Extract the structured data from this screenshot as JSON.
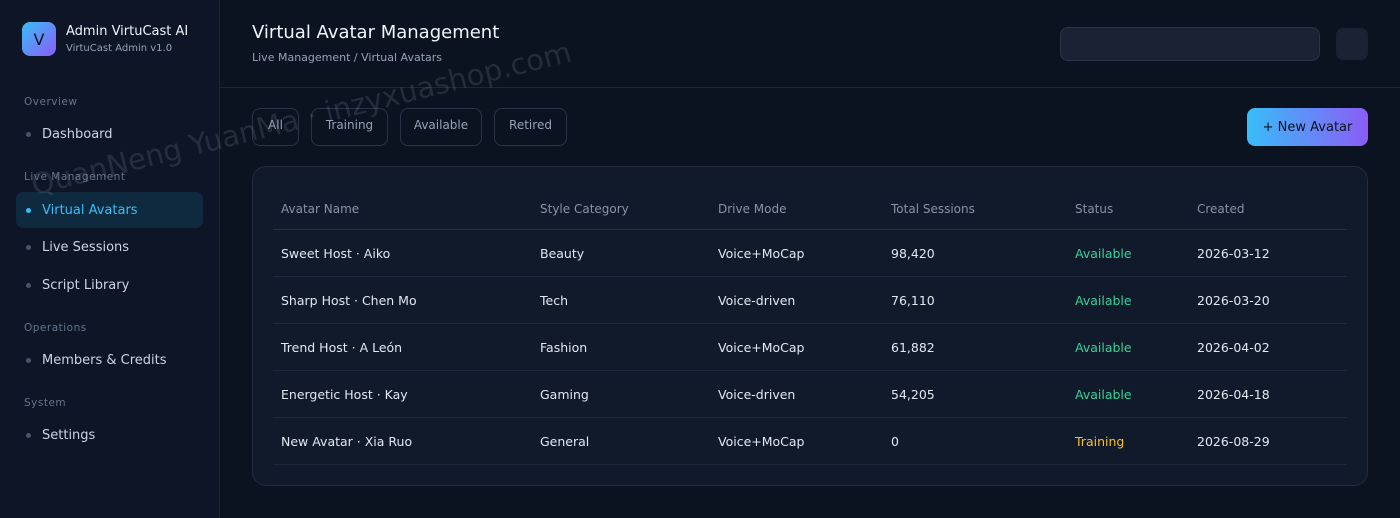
{
  "brand": {
    "logo_letter": "V",
    "name": "Admin VirtuCast AI",
    "subtitle": "VirtuCast Admin v1.0"
  },
  "sidebar": {
    "sections": [
      {
        "title": "Overview",
        "items": [
          {
            "label": "Dashboard",
            "active": false
          }
        ]
      },
      {
        "title": "Live Management",
        "items": [
          {
            "label": "Virtual Avatars",
            "active": true
          },
          {
            "label": "Live Sessions",
            "active": false
          },
          {
            "label": "Script Library",
            "active": false
          }
        ]
      },
      {
        "title": "Operations",
        "items": [
          {
            "label": "Members & Credits",
            "active": false
          }
        ]
      },
      {
        "title": "System",
        "items": [
          {
            "label": "Settings",
            "active": false
          }
        ]
      }
    ]
  },
  "header": {
    "title": "Virtual Avatar Management",
    "breadcrumb": "Live Management / Virtual Avatars",
    "search": {
      "value": "",
      "placeholder": ""
    }
  },
  "filters": [
    "All",
    "Training",
    "Available",
    "Retired"
  ],
  "new_button_label": "+ New Avatar",
  "table": {
    "columns": [
      "Avatar Name",
      "Style Category",
      "Drive Mode",
      "Total Sessions",
      "Status",
      "Created"
    ],
    "rows": [
      [
        "Sweet Host · Aiko",
        "Beauty",
        "Voice+MoCap",
        "98,420",
        "Available",
        "2026-03-12"
      ],
      [
        "Sharp Host · Chen Mo",
        "Tech",
        "Voice-driven",
        "76,110",
        "Available",
        "2026-03-20"
      ],
      [
        "Trend Host · A León",
        "Fashion",
        "Voice+MoCap",
        "61,882",
        "Available",
        "2026-04-02"
      ],
      [
        "Energetic Host · Kay",
        "Gaming",
        "Voice-driven",
        "54,205",
        "Available",
        "2026-04-18"
      ],
      [
        "New Avatar · Xia Ruo",
        "General",
        "Voice+MoCap",
        "0",
        "Training",
        "2026-08-29"
      ]
    ]
  },
  "watermark": "QuanNeng YuanMa · inzyxuashop.com",
  "colors": {
    "background": "#0b1220",
    "accent": "#38bdf8",
    "accent_gradient_end": "#8b5cf6",
    "status_available": "#34d399",
    "status_training": "#fbbf24"
  }
}
